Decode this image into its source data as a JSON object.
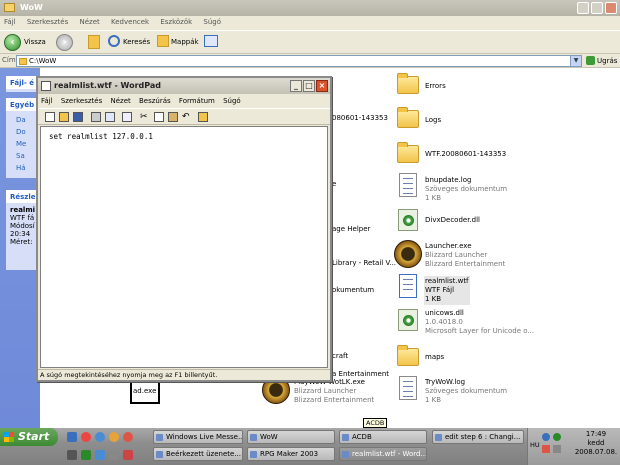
{
  "explorer": {
    "title": "WoW",
    "menu": [
      "Fájl",
      "Szerkesztés",
      "Nézet",
      "Kedvencek",
      "Eszközök",
      "Súgó"
    ],
    "toolbar": {
      "back": "Vissza",
      "search": "Keresés",
      "folders": "Mappák"
    },
    "address_label": "Cím",
    "address_value": "C:\\WoW",
    "go_label": "Ugrás"
  },
  "taskpane": {
    "file_box": "Fájl- é",
    "other_box": "Egyéb",
    "other_items": [
      "Da",
      "Do",
      "Me",
      "Sa",
      "Há"
    ],
    "details_box": "Részle",
    "details_name": "realmi",
    "details_type": "WTF fá",
    "details_mod_label": "Módosí",
    "details_time": "20:34",
    "details_size_label": "Méret:"
  },
  "files_left": [
    {
      "name": "080601-143353"
    },
    {
      "name": "e"
    },
    {
      "name": "age Helper"
    },
    {
      "name": "Library - Retail V..."
    },
    {
      "name": "okumentum"
    },
    {
      "name": "craft"
    },
    {
      "name": "a Entertainment"
    }
  ],
  "files_bottom": [
    {
      "name": "ad.exe"
    },
    {
      "name": "PlayWoW-WotLK.exe",
      "sub1": "Blizzard Launcher",
      "sub2": "Blizzard Entertainment"
    }
  ],
  "files_right": [
    {
      "name": "Errors"
    },
    {
      "name": "Logs"
    },
    {
      "name": "WTF.20080601-143353"
    },
    {
      "name": "bnupdate.log",
      "sub1": "Szöveges dokumentum",
      "sub2": "1 KB"
    },
    {
      "name": "DivxDecoder.dll"
    },
    {
      "name": "Launcher.exe",
      "sub1": "Blizzard Launcher",
      "sub2": "Blizzard Entertainment"
    },
    {
      "name": "realmlist.wtf",
      "sub1": "WTF Fájl",
      "sub2": "1 KB"
    },
    {
      "name": "unicows.dll",
      "sub1": "1.0.4018.0",
      "sub2": "Microsoft Layer for Unicode o..."
    },
    {
      "name": "maps"
    },
    {
      "name": "TryWoW.log",
      "sub1": "Szöveges dokumentum",
      "sub2": "1 KB"
    }
  ],
  "wordpad": {
    "title": "realmlist.wtf - WordPad",
    "menu": [
      "Fájl",
      "Szerkesztés",
      "Nézet",
      "Beszúrás",
      "Formátum",
      "Súgó"
    ],
    "content": "set realmlist 127.0.0.1",
    "status": "A súgó megtekintéséhez nyomja meg az F1 billentyűt."
  },
  "tooltip": "ACDB",
  "taskbar": {
    "start": "Start",
    "row1": [
      "Windows Live Messe...",
      "WoW",
      "ACDB",
      "edit step 6 : Changi..."
    ],
    "row2": [
      "Beérkezett üzenete...",
      "RPG Maker 2003",
      "realmlist.wtf - Word..."
    ],
    "lang": "HU",
    "time": "17:49",
    "day": "kedd",
    "date": "2008.07.08."
  },
  "colors": {
    "accent": "#215dc6",
    "selection": "#e6e6e6"
  }
}
